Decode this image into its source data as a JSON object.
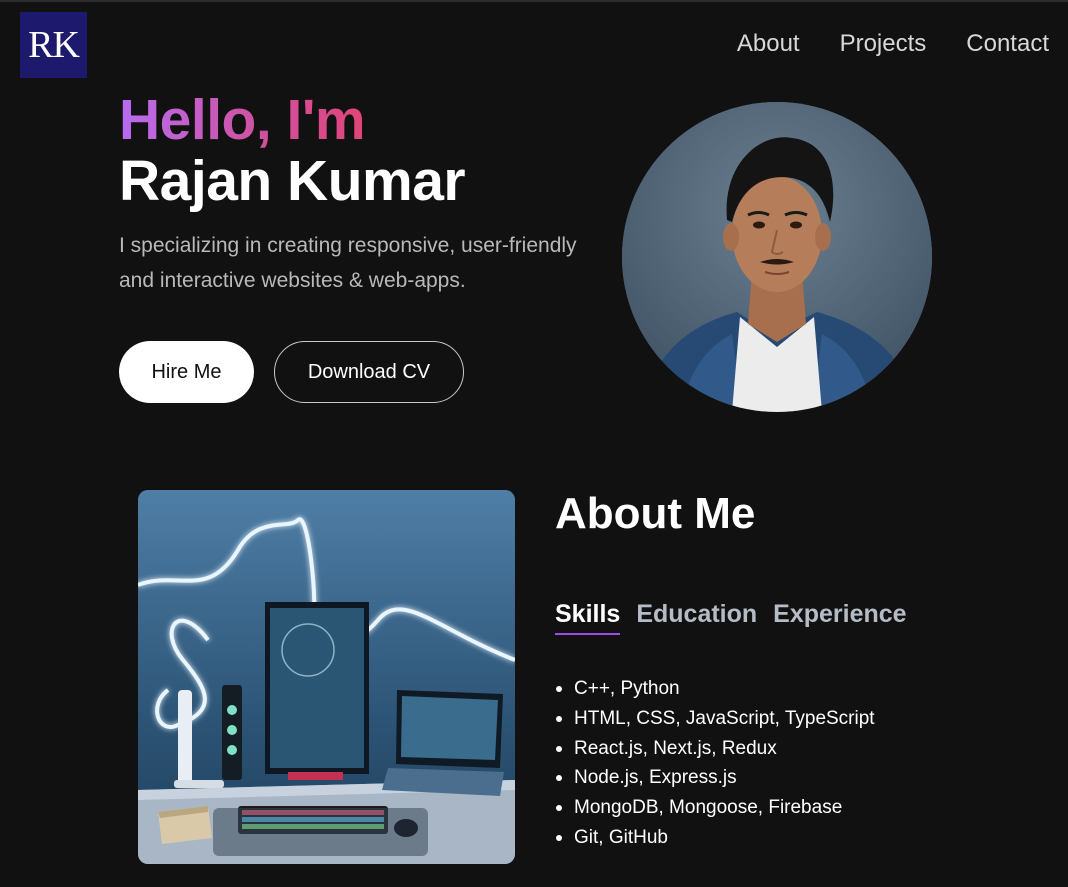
{
  "logo": {
    "text": "RK"
  },
  "nav": {
    "items": [
      {
        "label": "About"
      },
      {
        "label": "Projects"
      },
      {
        "label": "Contact"
      }
    ]
  },
  "hero": {
    "greeting": "Hello, I'm",
    "name": "Rajan Kumar",
    "intro": "I specializing in creating responsive, user-friendly and interactive websites & web-apps.",
    "hire_label": "Hire Me",
    "cv_label": "Download CV"
  },
  "about": {
    "title": "About Me",
    "tabs": [
      {
        "label": "Skills"
      },
      {
        "label": "Education"
      },
      {
        "label": "Experience"
      }
    ],
    "skills": [
      "C++, Python",
      "HTML, CSS, JavaScript, TypeScript",
      "React.js, Next.js, Redux",
      "Node.js, Express.js",
      "MongoDB, Mongoose, Firebase",
      "Git, GitHub"
    ]
  },
  "colors": {
    "background": "#111111",
    "logo_bg": "#1d1a6e",
    "gradient_start": "#b76cf2",
    "gradient_end": "#e0457a",
    "tab_underline": "#9b4ee6"
  }
}
